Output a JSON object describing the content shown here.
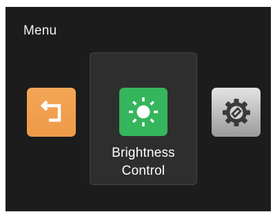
{
  "menu": {
    "title": "Menu",
    "items": [
      {
        "id": "back",
        "icon": "back-arrow-icon",
        "color": "#F0A050"
      },
      {
        "id": "brightness-control",
        "icon": "sun-icon",
        "color": "#35B55C",
        "selected": true,
        "label_line1": "Brightness",
        "label_line2": "Control"
      },
      {
        "id": "settings",
        "icon": "gear-icon",
        "color": "#BDBDBD"
      }
    ]
  },
  "colors": {
    "background": "#1C1C1C",
    "selected_card": "#2E2E2E",
    "text": "#FFFFFF"
  }
}
